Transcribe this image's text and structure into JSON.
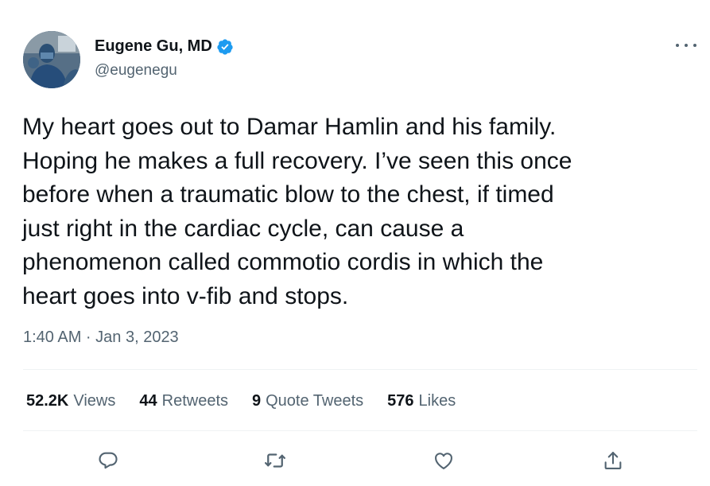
{
  "author": {
    "display_name": "Eugene Gu, MD",
    "handle": "@eugenegu",
    "avatar_icon": "avatar-photo",
    "verified_icon": "verified-badge-icon",
    "verified_color": "#1d9bf0"
  },
  "more_icon": "more-options-icon",
  "tweet": {
    "text": "My heart goes out to Damar Hamlin and his family.\nHoping he makes a full recovery. I’ve seen this once\nbefore when a traumatic blow to the chest, if timed\njust right in the cardiac cycle, can cause a\nphenomenon called commotio cordis in which the\nheart goes into v-fib and stops.",
    "timestamp": "1:40 AM · Jan 3, 2023"
  },
  "stats": {
    "views": {
      "count": "52.2K",
      "label": "Views"
    },
    "retweets": {
      "count": "44",
      "label": "Retweets"
    },
    "quote_tweets": {
      "count": "9",
      "label": "Quote Tweets"
    },
    "likes": {
      "count": "576",
      "label": "Likes"
    }
  },
  "actions": {
    "reply_icon": "reply-icon",
    "retweet_icon": "retweet-icon",
    "like_icon": "like-icon",
    "share_icon": "share-icon",
    "icon_color": "#536471"
  },
  "colors": {
    "text_primary": "#0f1419",
    "text_secondary": "#536471",
    "divider": "#eff3f4",
    "background": "#ffffff"
  }
}
